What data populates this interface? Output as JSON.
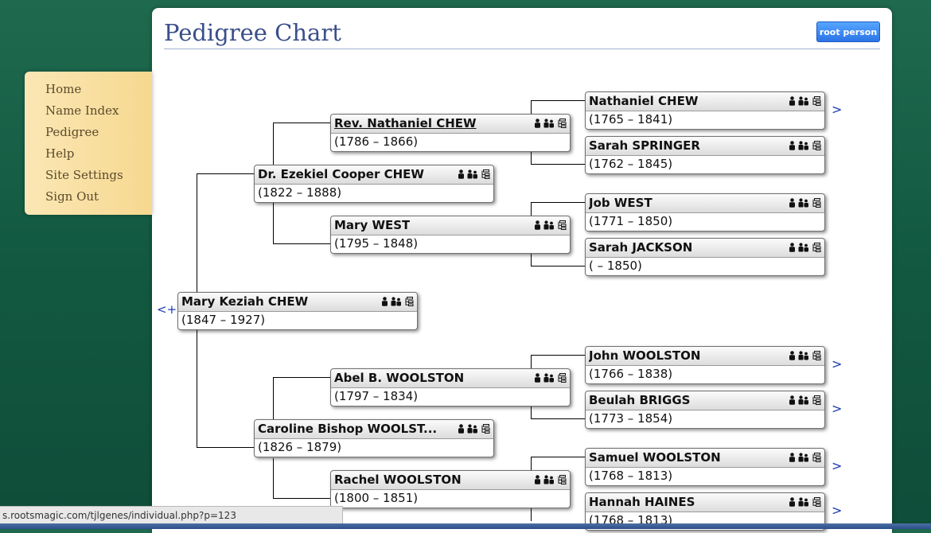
{
  "header": {
    "title": "Pedigree Chart",
    "root_button": "root person"
  },
  "sidebar": {
    "items": [
      "Home",
      "Name Index",
      "Pedigree",
      "Help",
      "Site Settings",
      "Sign Out"
    ]
  },
  "nav": {
    "back_label": "<+",
    "more_label": ">"
  },
  "people": [
    {
      "name": "Mary Keziah CHEW",
      "dates": "(1847 – 1927)"
    },
    {
      "name": "Dr. Ezekiel Cooper CHEW",
      "dates": "(1822 – 1888)"
    },
    {
      "name": "Caroline Bishop WOOLST...",
      "dates": "(1826 – 1879)"
    },
    {
      "name": "Rev. Nathaniel CHEW",
      "dates": "(1786 – 1866)"
    },
    {
      "name": "Mary WEST",
      "dates": "(1795 – 1848)"
    },
    {
      "name": "Abel B. WOOLSTON",
      "dates": "(1797 – 1834)"
    },
    {
      "name": "Rachel WOOLSTON",
      "dates": "(1800 – 1851)"
    },
    {
      "name": "Nathaniel CHEW",
      "dates": "(1765 – 1841)"
    },
    {
      "name": "Sarah SPRINGER",
      "dates": "(1762 – 1845)"
    },
    {
      "name": "Job WEST",
      "dates": "(1771 – 1850)"
    },
    {
      "name": "Sarah JACKSON",
      "dates": "( – 1850)"
    },
    {
      "name": "John WOOLSTON",
      "dates": "(1766 – 1838)"
    },
    {
      "name": "Beulah BRIGGS",
      "dates": "(1773 – 1854)"
    },
    {
      "name": "Samuel WOOLSTON",
      "dates": "(1768 – 1813)"
    },
    {
      "name": "Hannah HAINES",
      "dates": "(1768 – 1813)"
    }
  ],
  "status_url": "s.rootsmagic.com/tjlgenes/individual.php?p=123",
  "icons": [
    "person-icon",
    "family-icon",
    "descendants-icon"
  ]
}
